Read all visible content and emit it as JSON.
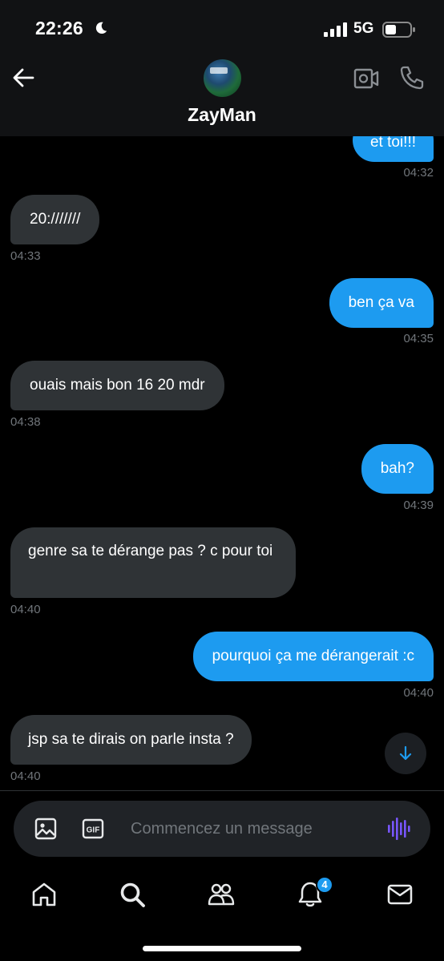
{
  "status_bar": {
    "time": "22:26",
    "network": "5G",
    "icons": [
      "moon-icon",
      "signal-icon",
      "battery-icon"
    ]
  },
  "header": {
    "contact_name": "ZayMan",
    "icons": [
      "back-arrow-icon",
      "avatar",
      "video-call-icon",
      "phone-icon"
    ]
  },
  "messages": [
    {
      "text": "et toi!!!",
      "time": "04:32",
      "direction": "out"
    },
    {
      "text": "20:///////",
      "time": "04:33",
      "direction": "in"
    },
    {
      "text": "ben ça va",
      "time": "04:35",
      "direction": "out"
    },
    {
      "text": "ouais mais bon 16 20 mdr",
      "time": "04:38",
      "direction": "in"
    },
    {
      "text": "bah?",
      "time": "04:39",
      "direction": "out"
    },
    {
      "text": "genre sa te dérange pas ? c pour toi",
      "time": "04:40",
      "direction": "in"
    },
    {
      "text": "pourquoi ça me dérangerait :c",
      "time": "04:40",
      "direction": "out"
    },
    {
      "text": "jsp sa te dirais on parle insta ?",
      "time": "04:40",
      "direction": "in"
    }
  ],
  "composer": {
    "placeholder": "Commencez un message",
    "gif_label": "GIF"
  },
  "bottom_nav": {
    "items": [
      "home-icon",
      "search-icon",
      "communities-icon",
      "notifications-icon",
      "messages-icon"
    ],
    "notifications_badge": "4"
  },
  "colors": {
    "accent": "#1d9bf0",
    "incoming_bubble": "#2f3336",
    "voice_accent": "#7856ff",
    "muted_text": "#71767b"
  }
}
